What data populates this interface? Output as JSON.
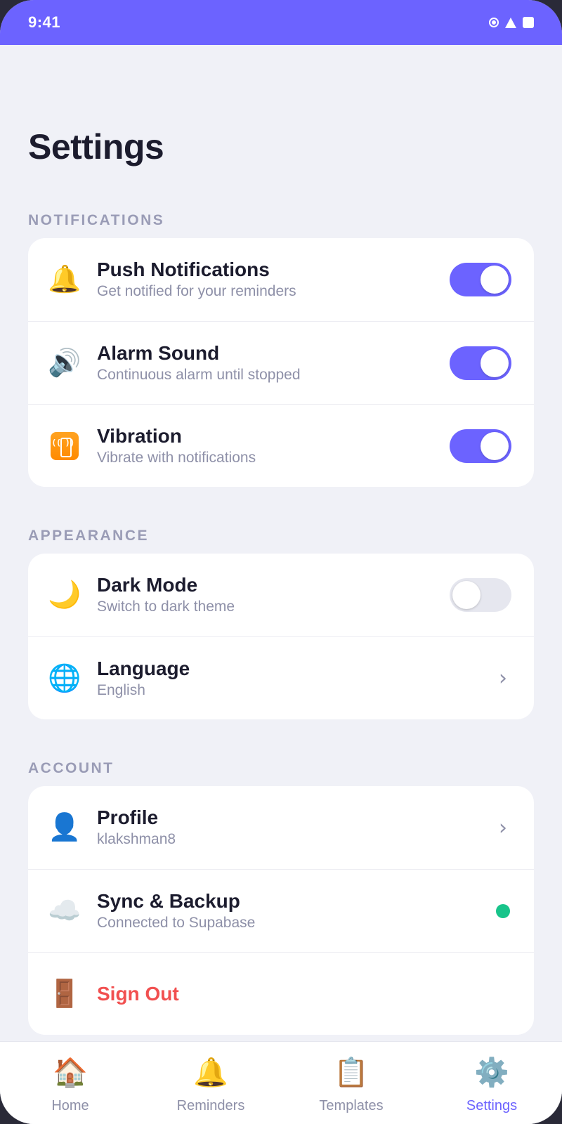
{
  "status_bar": {
    "time": "9:41"
  },
  "page_title": "Settings",
  "colors": {
    "accent": "#6c63ff",
    "danger": "#f15050",
    "online": "#18c48a"
  },
  "sections": {
    "notifications": {
      "header": "NOTIFICATIONS",
      "push": {
        "title": "Push Notifications",
        "subtitle": "Get notified for your reminders",
        "icon": "bell-icon",
        "enabled": true
      },
      "alarm": {
        "title": "Alarm Sound",
        "subtitle": "Continuous alarm until stopped",
        "icon": "speaker-icon",
        "enabled": true
      },
      "vibration": {
        "title": "Vibration",
        "subtitle": "Vibrate with notifications",
        "icon": "vibration-icon",
        "enabled": true
      }
    },
    "appearance": {
      "header": "APPEARANCE",
      "dark_mode": {
        "title": "Dark Mode",
        "subtitle": "Switch to dark theme",
        "icon": "moon-icon",
        "enabled": false
      },
      "language": {
        "title": "Language",
        "subtitle": "English",
        "icon": "globe-icon"
      }
    },
    "account": {
      "header": "ACCOUNT",
      "profile": {
        "title": "Profile",
        "subtitle": "klakshman8",
        "icon": "user-icon"
      },
      "sync": {
        "title": "Sync & Backup",
        "subtitle": "Connected to Supabase",
        "icon": "cloud-icon"
      },
      "sign_out": {
        "title": "Sign Out",
        "icon": "door-icon"
      }
    }
  },
  "tabs": [
    {
      "label": "Home",
      "icon": "house-icon"
    },
    {
      "label": "Reminders",
      "icon": "bell-icon"
    },
    {
      "label": "Templates",
      "icon": "clipboard-icon"
    },
    {
      "label": "Settings",
      "icon": "gear-icon",
      "active": true
    }
  ]
}
